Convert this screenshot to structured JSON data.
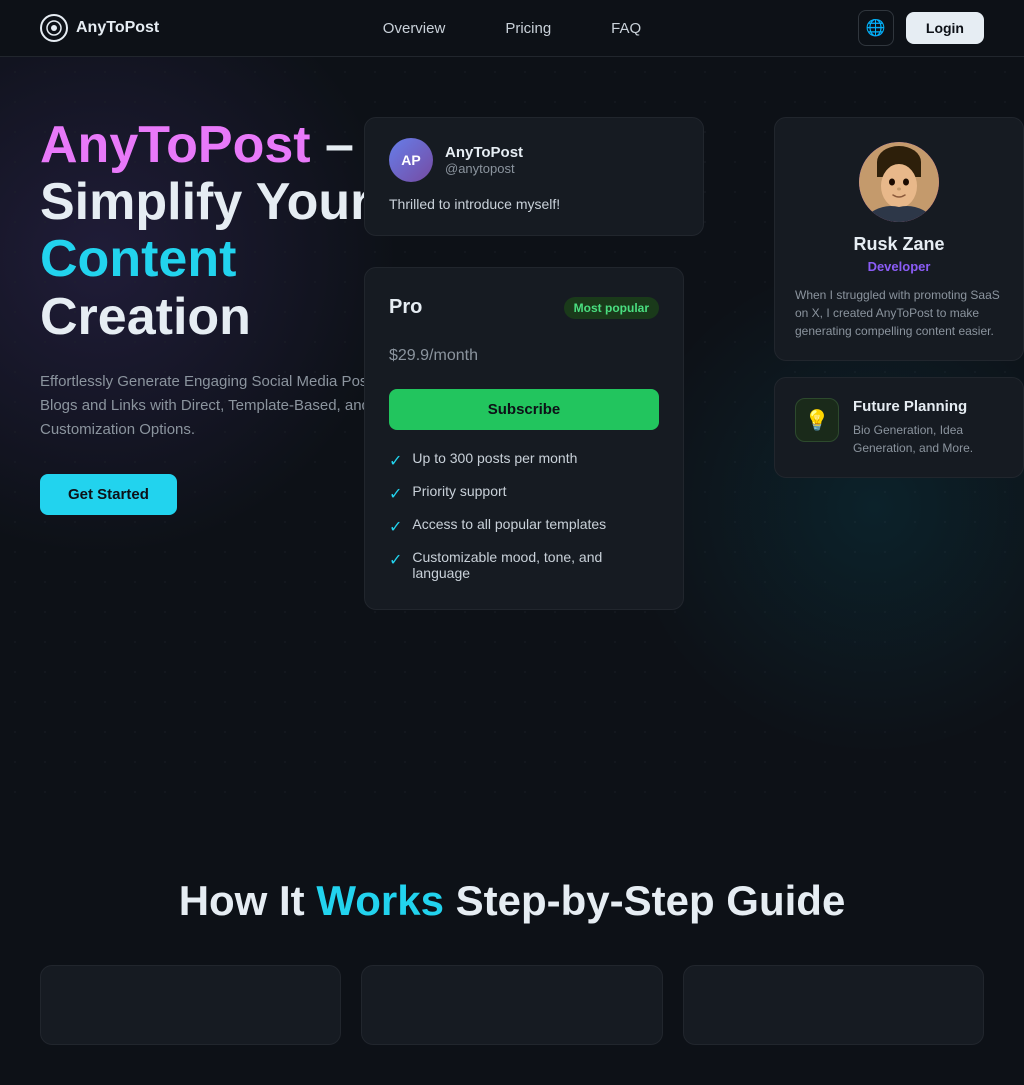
{
  "nav": {
    "logo_text": "AnyToPost",
    "links": [
      {
        "label": "Overview"
      },
      {
        "label": "Pricing"
      },
      {
        "label": "FAQ"
      }
    ],
    "login_label": "Login"
  },
  "hero": {
    "title_brand": "AnyToPost",
    "title_rest": " – Simplify Your ",
    "title_accent": "Content",
    "title_end": " Creation",
    "subtitle": "Effortlessly Generate Engaging Social Media Posts from Blogs and Links with Direct, Template-Based, and Customization Options.",
    "cta_label": "Get Started"
  },
  "post_card": {
    "avatar_initials": "AP",
    "name": "AnyToPost",
    "handle": "@anytopost",
    "text": "Thrilled to introduce myself!"
  },
  "pricing_card": {
    "plan": "Pro",
    "badge": "Most popular",
    "price": "$29.9",
    "period": "/month",
    "subscribe_label": "Subscribe",
    "features": [
      "Up to 300 posts per month",
      "Priority support",
      "Access to all popular templates",
      "Customizable mood, tone, and language"
    ]
  },
  "dev_card": {
    "name": "Rusk Zane",
    "role": "Developer",
    "description": "When I struggled with promoting SaaS on X, I created AnyToPost to make generating compelling content easier."
  },
  "future_card": {
    "title": "Future Planning",
    "description": "Bio Generation, Idea Generation, and More."
  },
  "how_section": {
    "title_part1": "How It ",
    "title_accent": "Works",
    "title_part2": " Step-by-Step Guide"
  }
}
